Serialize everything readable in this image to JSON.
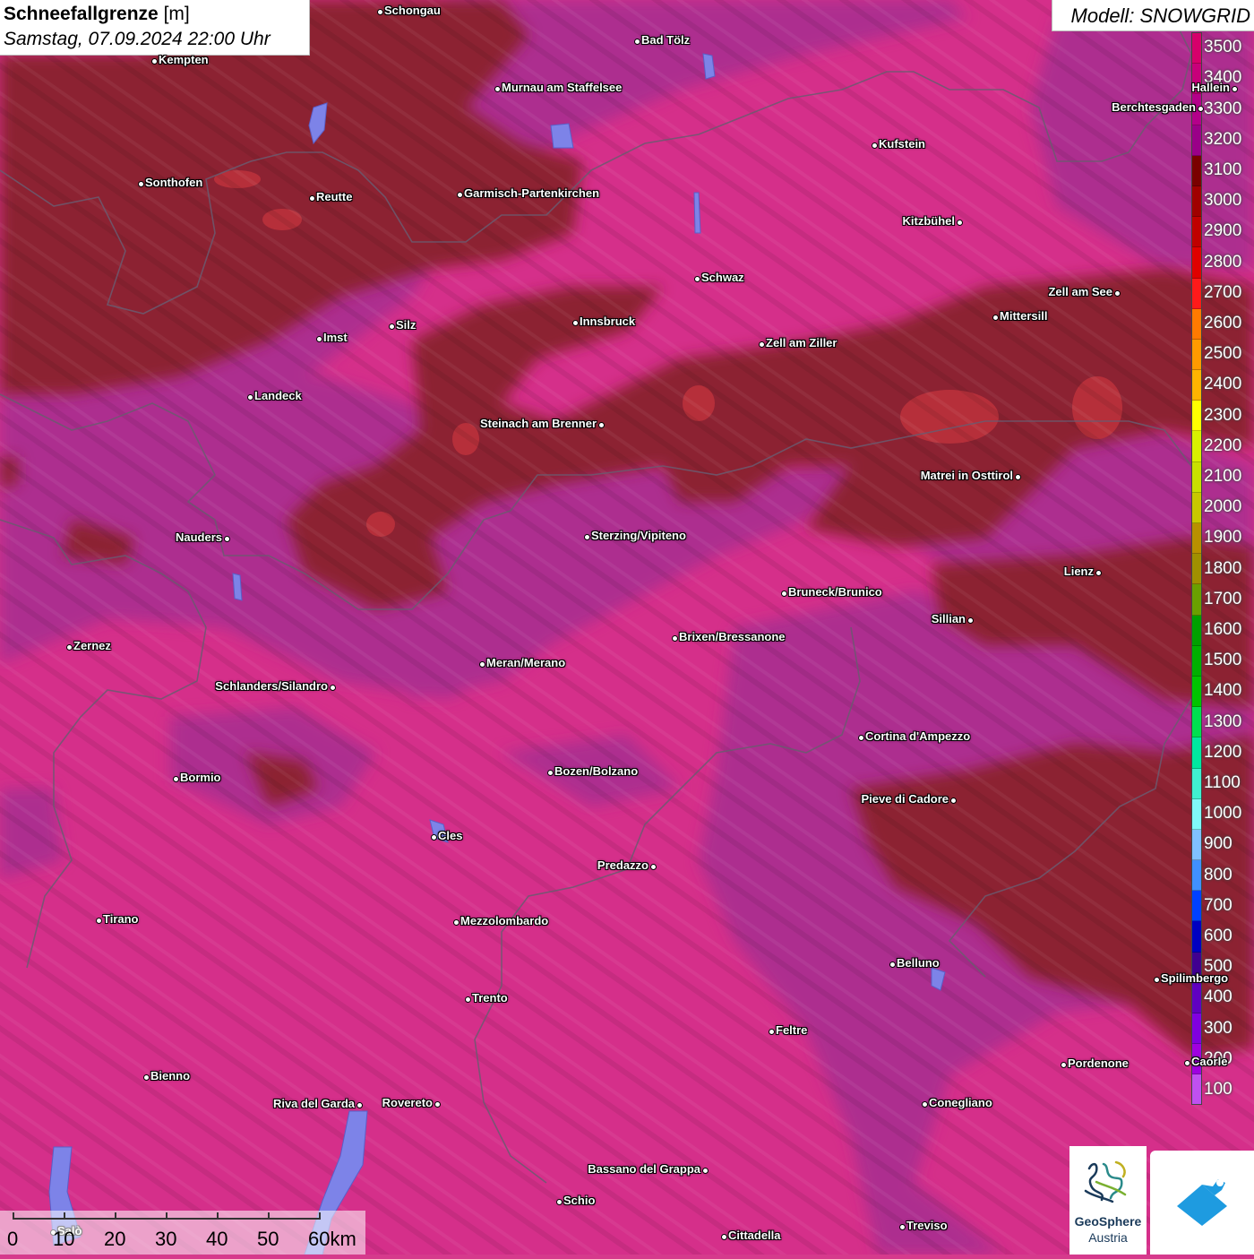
{
  "title": {
    "variable": "Schneefallgrenze",
    "unit": "[m]",
    "datetime": "Samstag, 07.09.2024 22:00 Uhr"
  },
  "model_label": "Modell: SNOWGRID",
  "legend": {
    "values": [
      "3500",
      "3400",
      "3300",
      "3200",
      "3100",
      "3000",
      "2900",
      "2800",
      "2700",
      "2600",
      "2500",
      "2400",
      "2300",
      "2200",
      "2100",
      "2000",
      "1900",
      "1800",
      "1700",
      "1600",
      "1500",
      "1400",
      "1300",
      "1200",
      "1100",
      "1000",
      "900",
      "800",
      "700",
      "600",
      "500",
      "400",
      "300",
      "200",
      "100"
    ],
    "colors": [
      "#d6006b",
      "#c8007a",
      "#b4008a",
      "#9a0088",
      "#7a0000",
      "#a00000",
      "#c00000",
      "#e00000",
      "#ff1a1a",
      "#ff7a00",
      "#ff9a00",
      "#ffb400",
      "#ffff00",
      "#d8f000",
      "#c8e000",
      "#c8c800",
      "#b89000",
      "#a09000",
      "#6aa000",
      "#00a000",
      "#00b000",
      "#00c400",
      "#00e050",
      "#00e8a0",
      "#40f0d0",
      "#80f8f8",
      "#80c0ff",
      "#4090ff",
      "#0040ff",
      "#0000c0",
      "#400090",
      "#6000c0",
      "#8000e0",
      "#a000e0",
      "#c050f0"
    ]
  },
  "places": [
    {
      "name": "Schongau"
    },
    {
      "name": "Bad Tölz"
    },
    {
      "name": "Kempten"
    },
    {
      "name": "Murnau am Staffelsee"
    },
    {
      "name": "Hallein"
    },
    {
      "name": "Berchtesgaden"
    },
    {
      "name": "Kufstein"
    },
    {
      "name": "Sonthofen"
    },
    {
      "name": "Reutte"
    },
    {
      "name": "Garmisch-Partenkirchen"
    },
    {
      "name": "Kitzbühel"
    },
    {
      "name": "Schwaz"
    },
    {
      "name": "Zell am See"
    },
    {
      "name": "Mittersill"
    },
    {
      "name": "Innsbruck"
    },
    {
      "name": "Imst"
    },
    {
      "name": "Silz"
    },
    {
      "name": "Zell am Ziller"
    },
    {
      "name": "Landeck"
    },
    {
      "name": "Steinach am Brenner"
    },
    {
      "name": "Matrei in Osttirol"
    },
    {
      "name": "Nauders"
    },
    {
      "name": "Sterzing/Vipiteno"
    },
    {
      "name": "Lienz"
    },
    {
      "name": "Bruneck/Brunico"
    },
    {
      "name": "Sillian"
    },
    {
      "name": "Zernez"
    },
    {
      "name": "Brixen/Bressanone"
    },
    {
      "name": "Meran/Merano"
    },
    {
      "name": "Schlanders/Silandro"
    },
    {
      "name": "Cortina d'Ampezzo"
    },
    {
      "name": "Bozen/Bolzano"
    },
    {
      "name": "Bormio"
    },
    {
      "name": "Pieve di Cadore"
    },
    {
      "name": "Cles"
    },
    {
      "name": "Predazzo"
    },
    {
      "name": "Tirano"
    },
    {
      "name": "Mezzolombardo"
    },
    {
      "name": "Belluno"
    },
    {
      "name": "Spilimbergo"
    },
    {
      "name": "Trento"
    },
    {
      "name": "Feltre"
    },
    {
      "name": "Pordenone"
    },
    {
      "name": "Bienno"
    },
    {
      "name": "Riva del Garda"
    },
    {
      "name": "Rovereto"
    },
    {
      "name": "Conegliano"
    },
    {
      "name": "Bassano del Grappa"
    },
    {
      "name": "Schio"
    },
    {
      "name": "Treviso"
    },
    {
      "name": "Cittadella"
    },
    {
      "name": "Salò"
    },
    {
      "name": "Caorle"
    }
  ],
  "scale_bar": {
    "labels": [
      "0",
      "10",
      "20",
      "30",
      "40",
      "50",
      "60km"
    ]
  },
  "logo": {
    "line1": "GeoSphere",
    "line2": "Austria"
  },
  "colors": {
    "snowline_high": "#d6006b",
    "snowline_mid": "#9a0088",
    "snowline_3100": "#7a0000",
    "snowline_3000": "#a00000"
  }
}
